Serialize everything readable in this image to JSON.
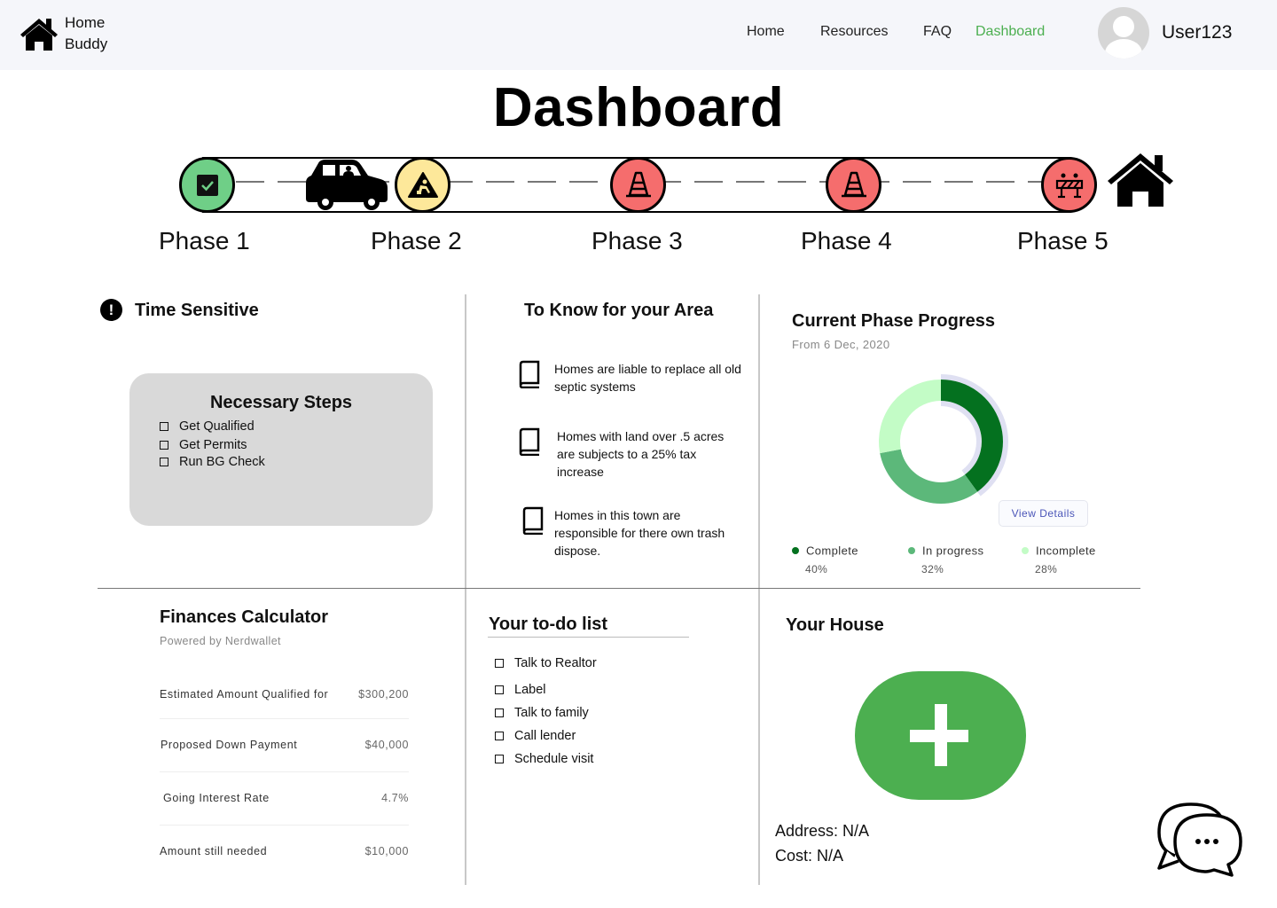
{
  "header": {
    "logo_line1": "Home",
    "logo_line2": "Buddy",
    "logo_icon": "house-icon",
    "nav": [
      {
        "label": "Home",
        "active": false
      },
      {
        "label": "Resources",
        "active": false
      },
      {
        "label": "FAQ",
        "active": false
      },
      {
        "label": "Dashboard",
        "active": true
      }
    ],
    "username": "User123",
    "avatar_icon": "user-avatar-icon"
  },
  "page_title": "Dashboard",
  "timeline": {
    "current_marker_icon": "car-icon",
    "goal_icon": "house-icon",
    "phases": [
      {
        "label": "Phase 1",
        "status": "complete",
        "icon": "checkbox-check-icon",
        "color": "#6fcf87"
      },
      {
        "label": "Phase 2",
        "status": "in-progress",
        "icon": "construction-worker-icon",
        "color": "#fde89a"
      },
      {
        "label": "Phase 3",
        "status": "not-started",
        "icon": "traffic-cone-icon",
        "color": "#f56d6d"
      },
      {
        "label": "Phase 4",
        "status": "not-started",
        "icon": "traffic-cone-icon",
        "color": "#f56d6d"
      },
      {
        "label": "Phase 5",
        "status": "not-started",
        "icon": "road-barrier-icon",
        "color": "#f56d6d"
      }
    ]
  },
  "time_sensitive": {
    "title": "Time Sensitive",
    "icon": "exclamation-icon",
    "card_title": "Necessary Steps",
    "steps": [
      {
        "label": "Get Qualified",
        "checked": false
      },
      {
        "label": "Get Permits",
        "checked": false
      },
      {
        "label": "Run BG Check",
        "checked": false
      }
    ]
  },
  "area": {
    "title": "To Know for your Area",
    "items": [
      {
        "text": "Homes are liable to replace all old septic systems",
        "icon": "book-icon"
      },
      {
        "text": "Homes with land over .5 acres are subjects to a 25% tax increase",
        "icon": "book-icon"
      },
      {
        "text": "Homes in this town are responsible for there own trash dispose.",
        "icon": "book-icon"
      }
    ]
  },
  "progress": {
    "title": "Current Phase Progress",
    "subtitle": "From 6 Dec, 2020",
    "button": "View Details",
    "legend": [
      {
        "label": "Complete",
        "value": "40%"
      },
      {
        "label": "In progress",
        "value": "32%"
      },
      {
        "label": "Incomplete",
        "value": "28%"
      }
    ]
  },
  "chart_data": {
    "type": "pie",
    "variant": "donut",
    "title": "Current Phase Progress",
    "categories": [
      "Complete",
      "In progress",
      "Incomplete"
    ],
    "values": [
      40,
      32,
      28
    ],
    "colors": [
      "#04711f",
      "#5cb87a",
      "#c3fcc6"
    ],
    "highlight_color": "#dfe0f2",
    "legend": "bottom"
  },
  "finances": {
    "title": "Finances Calculator",
    "subtitle": "Powered by Nerdwallet",
    "rows": [
      {
        "label": "Estimated Amount Qualified for",
        "value": "$300,200"
      },
      {
        "label": "Proposed Down Payment",
        "value": "$40,000"
      },
      {
        "label": "Going Interest Rate",
        "value": "4.7%"
      },
      {
        "label": "Amount still needed",
        "value": "$10,000"
      }
    ]
  },
  "todo": {
    "title": "Your to-do list",
    "items": [
      {
        "label": "Talk to Realtor",
        "checked": false
      },
      {
        "label": "Label",
        "checked": false
      },
      {
        "label": "Talk to family",
        "checked": false
      },
      {
        "label": "Call lender",
        "checked": false
      },
      {
        "label": "Schedule visit",
        "checked": false
      }
    ]
  },
  "house": {
    "title": "Your House",
    "add_icon": "plus-icon",
    "address": "Address: N/A",
    "cost": "Cost: N/A"
  },
  "chat": {
    "icon": "chat-bubbles-icon"
  }
}
